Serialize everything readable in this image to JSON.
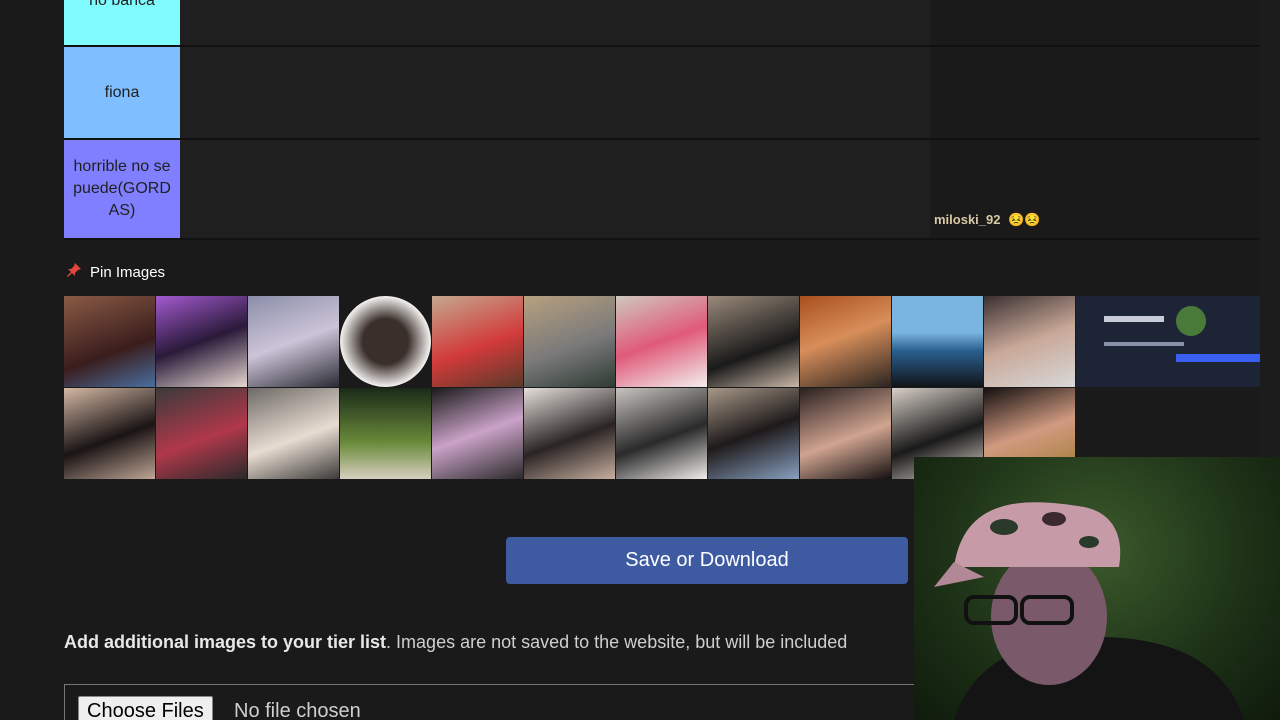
{
  "tiers": [
    {
      "label": "no banca",
      "color": "#80fcff"
    },
    {
      "label": "fiona",
      "color": "#7fbfff"
    },
    {
      "label": "horrible no se puede(GORDAS)",
      "color": "#7f7fff"
    }
  ],
  "overlay": {
    "username": "miloski_92",
    "emotes": "😣😣"
  },
  "pin": {
    "icon": "pushpin-icon",
    "label": "Pin Images"
  },
  "save_button": "Save or Download",
  "add_images": {
    "bold": "Add additional images to your tier list",
    "rest": ". Images are not saved to the website, but will be included"
  },
  "file_input": {
    "button": "Choose Files",
    "status": "No file chosen"
  },
  "colors": {
    "save_button": "#3e5aa1",
    "background": "#1a1a1b"
  }
}
